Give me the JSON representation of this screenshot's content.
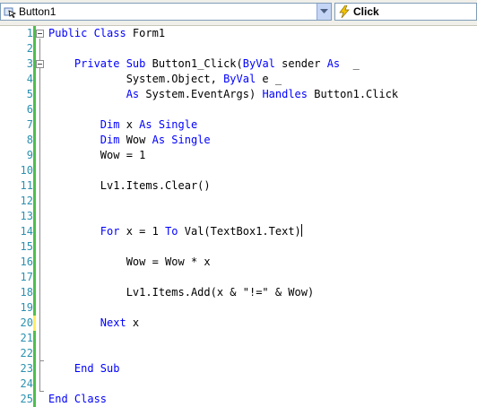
{
  "toolbar": {
    "object_combo": {
      "text": "Button1",
      "icon": "control-icon"
    },
    "event_combo": {
      "text": "Click",
      "icon": "lightning-icon"
    }
  },
  "colors": {
    "keyword": "#0000ff",
    "line_number": "#2b91af",
    "saved_change": "#4dbf4d",
    "unsaved_change": "#ffee62"
  },
  "editor": {
    "lines": [
      {
        "num": "1",
        "change": "saved",
        "segments": [
          {
            "t": "Public Class",
            "k": 1
          },
          {
            "t": " Form1",
            "k": 0
          }
        ]
      },
      {
        "num": "2",
        "change": "saved",
        "segments": []
      },
      {
        "num": "3",
        "change": "saved",
        "segments": [
          {
            "t": "    ",
            "k": 0
          },
          {
            "t": "Private Sub",
            "k": 1
          },
          {
            "t": " Button1_Click(",
            "k": 0
          },
          {
            "t": "ByVal",
            "k": 1
          },
          {
            "t": " sender ",
            "k": 0
          },
          {
            "t": "As",
            "k": 1
          },
          {
            "t": "  _",
            "k": 0
          }
        ]
      },
      {
        "num": "4",
        "change": "saved",
        "segments": [
          {
            "t": "            System.Object, ",
            "k": 0
          },
          {
            "t": "ByVal",
            "k": 1
          },
          {
            "t": " e _",
            "k": 0
          }
        ]
      },
      {
        "num": "5",
        "change": "saved",
        "segments": [
          {
            "t": "            ",
            "k": 0
          },
          {
            "t": "As",
            "k": 1
          },
          {
            "t": " System.EventArgs) ",
            "k": 0
          },
          {
            "t": "Handles",
            "k": 1
          },
          {
            "t": " Button1.Click",
            "k": 0
          }
        ]
      },
      {
        "num": "6",
        "change": "saved",
        "segments": []
      },
      {
        "num": "7",
        "change": "saved",
        "segments": [
          {
            "t": "        ",
            "k": 0
          },
          {
            "t": "Dim",
            "k": 1
          },
          {
            "t": " x ",
            "k": 0
          },
          {
            "t": "As Single",
            "k": 1
          }
        ]
      },
      {
        "num": "8",
        "change": "saved",
        "segments": [
          {
            "t": "        ",
            "k": 0
          },
          {
            "t": "Dim",
            "k": 1
          },
          {
            "t": " Wow ",
            "k": 0
          },
          {
            "t": "As Single",
            "k": 1
          }
        ]
      },
      {
        "num": "9",
        "change": "saved",
        "segments": [
          {
            "t": "        Wow = 1",
            "k": 0
          }
        ]
      },
      {
        "num": "10",
        "change": "saved",
        "segments": []
      },
      {
        "num": "11",
        "change": "saved",
        "segments": [
          {
            "t": "        Lv1.Items.Clear()",
            "k": 0
          }
        ]
      },
      {
        "num": "12",
        "change": "saved",
        "segments": []
      },
      {
        "num": "13",
        "change": "saved",
        "segments": []
      },
      {
        "num": "14",
        "change": "saved",
        "segments": [
          {
            "t": "        ",
            "k": 0
          },
          {
            "t": "For",
            "k": 1
          },
          {
            "t": " x = 1 ",
            "k": 0
          },
          {
            "t": "To",
            "k": 1
          },
          {
            "t": " Val(TextBox1.Text)",
            "k": 0
          }
        ],
        "caret": true
      },
      {
        "num": "15",
        "change": "saved",
        "segments": []
      },
      {
        "num": "16",
        "change": "saved",
        "segments": [
          {
            "t": "            Wow = Wow * x",
            "k": 0
          }
        ]
      },
      {
        "num": "17",
        "change": "saved",
        "segments": []
      },
      {
        "num": "18",
        "change": "saved",
        "segments": [
          {
            "t": "            Lv1.Items.Add(x & \"!=\" & Wow)",
            "k": 0
          }
        ]
      },
      {
        "num": "19",
        "change": "saved",
        "segments": []
      },
      {
        "num": "20",
        "change": "unsaved",
        "segments": [
          {
            "t": "        ",
            "k": 0
          },
          {
            "t": "Next",
            "k": 1
          },
          {
            "t": " x",
            "k": 0
          }
        ]
      },
      {
        "num": "21",
        "change": "saved",
        "segments": []
      },
      {
        "num": "22",
        "change": "saved",
        "segments": []
      },
      {
        "num": "23",
        "change": "saved",
        "segments": [
          {
            "t": "    ",
            "k": 0
          },
          {
            "t": "End Sub",
            "k": 1
          }
        ]
      },
      {
        "num": "24",
        "change": "saved",
        "segments": []
      },
      {
        "num": "25",
        "change": "saved",
        "segments": [
          {
            "t": "End Class",
            "k": 1
          }
        ]
      }
    ]
  }
}
